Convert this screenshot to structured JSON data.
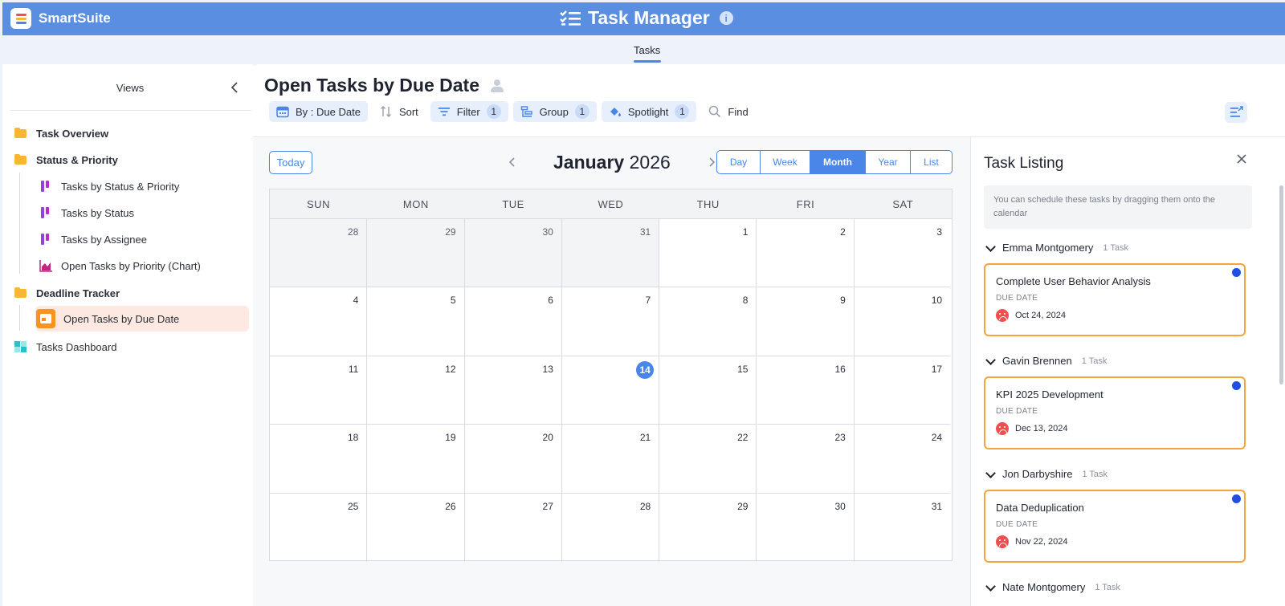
{
  "brand": {
    "name": "SmartSuite"
  },
  "app": {
    "title": "Task Manager"
  },
  "tabs": [
    {
      "label": "Tasks",
      "active": true
    }
  ],
  "sidebar": {
    "title": "Views",
    "items": [
      {
        "label": "Task Overview",
        "type": "folder"
      },
      {
        "label": "Status & Priority",
        "type": "folder"
      },
      {
        "label": "Tasks by Status & Priority",
        "type": "kanban"
      },
      {
        "label": "Tasks by Status",
        "type": "kanban"
      },
      {
        "label": "Tasks by Assignee",
        "type": "kanban"
      },
      {
        "label": "Open Tasks by Priority (Chart)",
        "type": "chart"
      },
      {
        "label": "Deadline Tracker",
        "type": "folder"
      },
      {
        "label": "Open Tasks by Due Date",
        "type": "calendar",
        "active": true
      },
      {
        "label": "Tasks Dashboard",
        "type": "dashboard"
      }
    ]
  },
  "view": {
    "title": "Open Tasks by Due Date",
    "toolbar": {
      "by_label": "By : Due Date",
      "sort_label": "Sort",
      "filter_label": "Filter",
      "filter_count": "1",
      "group_label": "Group",
      "group_count": "1",
      "spotlight_label": "Spotlight",
      "spotlight_count": "1",
      "find_label": "Find"
    }
  },
  "calendar": {
    "today_label": "Today",
    "month": "January",
    "year": "2026",
    "views": [
      "Day",
      "Week",
      "Month",
      "Year",
      "List"
    ],
    "active_view": "Month",
    "weekdays": [
      "SUN",
      "MON",
      "TUE",
      "WED",
      "THU",
      "FRI",
      "SAT"
    ],
    "days": [
      [
        "28",
        "29",
        "30",
        "31",
        "1",
        "2",
        "3"
      ],
      [
        "4",
        "5",
        "6",
        "7",
        "8",
        "9",
        "10"
      ],
      [
        "11",
        "12",
        "13",
        "14",
        "15",
        "16",
        "17"
      ],
      [
        "18",
        "19",
        "20",
        "21",
        "22",
        "23",
        "24"
      ],
      [
        "25",
        "26",
        "27",
        "28",
        "29",
        "30",
        "31"
      ]
    ],
    "today": "14"
  },
  "listing": {
    "title": "Task Listing",
    "hint": "You can schedule these tasks by dragging them onto the calendar",
    "groups": [
      {
        "assignee": "Emma Montgomery",
        "count": "1 Task",
        "task": {
          "title": "Complete User Behavior Analysis",
          "date_label": "DUE DATE",
          "date": "Oct 24, 2024"
        }
      },
      {
        "assignee": "Gavin Brennen",
        "count": "1 Task",
        "task": {
          "title": "KPI 2025 Development",
          "date_label": "DUE DATE",
          "date": "Dec 13, 2024"
        }
      },
      {
        "assignee": "Jon Darbyshire",
        "count": "1 Task",
        "task": {
          "title": "Data Deduplication",
          "date_label": "DUE DATE",
          "date": "Nov 22, 2024"
        }
      },
      {
        "assignee": "Nate Montgomery",
        "count": "1 Task"
      }
    ]
  },
  "colors": {
    "header": "#5a8ee1",
    "accent": "#4a86e8",
    "card_border": "#f7a23b",
    "overdue": "#f04f4f"
  }
}
